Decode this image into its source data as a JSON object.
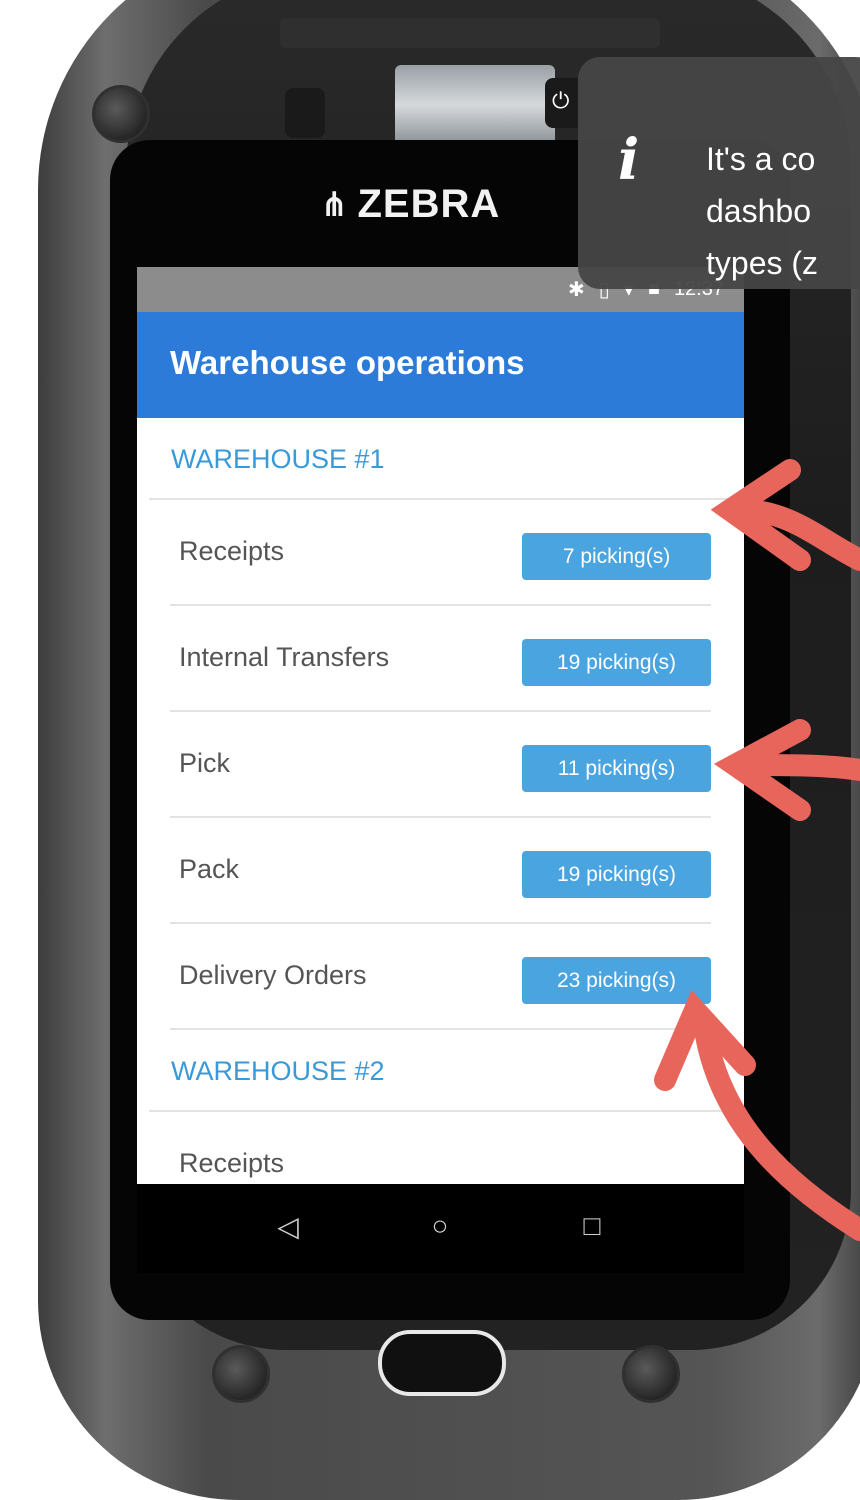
{
  "device": {
    "brand": "ZEBRA"
  },
  "status_bar": {
    "time": "12:37",
    "icons": [
      "bluetooth-icon",
      "vibrate-icon",
      "wifi-icon",
      "signal-icon"
    ]
  },
  "app_bar": {
    "title": "Warehouse operations"
  },
  "warehouses": [
    {
      "name": "WAREHOUSE #1",
      "operations": [
        {
          "label": "Receipts",
          "count": "7 picking(s)"
        },
        {
          "label": "Internal Transfers",
          "count": "19 picking(s)"
        },
        {
          "label": "Pick",
          "count": "11 picking(s)"
        },
        {
          "label": "Pack",
          "count": "19 picking(s)"
        },
        {
          "label": "Delivery Orders",
          "count": "23 picking(s)"
        }
      ]
    },
    {
      "name": "WAREHOUSE #2",
      "operations": [
        {
          "label": "Receipts"
        }
      ]
    }
  ],
  "nav_bar": {
    "back": "◁",
    "home": "○",
    "recents": "□"
  },
  "tooltip": {
    "icon": "i",
    "text": "It's a co\ndashbo\ntypes (z"
  },
  "colors": {
    "app_bar": "#2c7bd8",
    "badge": "#4aa4e0",
    "warehouse_header": "#3a9ad9",
    "arrow": "#e8655c"
  }
}
